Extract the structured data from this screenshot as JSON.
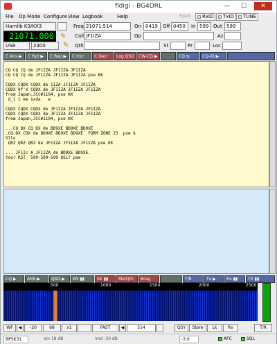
{
  "window": {
    "title": "fldigi - BG4DRL",
    "minimize": "—",
    "maximize": "☐",
    "close": "✕"
  },
  "menu": [
    "File",
    "Op Mode",
    "Configure",
    "View",
    "Logbook",
    "Help"
  ],
  "status_buttons": {
    "spot": "Spot",
    "rxid": "RxID",
    "txid": "TxID",
    "tune": "TUNE"
  },
  "rig": {
    "name": "Hamlib K3/KX3",
    "freq_display": "21071.000",
    "mode": "USB",
    "bw": "2400"
  },
  "log": {
    "freq_label": "Freq",
    "freq": "21071.514",
    "on_label": "On",
    "on": "0419",
    "off_label": "Off",
    "off": "0450",
    "in_label": "In",
    "in": "599",
    "out_label": "Out",
    "out": "599",
    "call_label": "Call",
    "call": "JF1IZA",
    "op_label": "Op",
    "az_label": "Az",
    "qth_label": "Qth",
    "st_label": "St",
    "pr_label": "Pr",
    "loc_label": "Loc"
  },
  "macros": [
    "C Ans ▶",
    "C Rpt ▶",
    "C Rep ▶",
    "C Incr",
    "C Decr",
    "Log QSO",
    "CW-CQ ▶",
    "CQ ⇆",
    "CQ-ID ▶"
  ],
  "macros2": [
    "CQ ▶",
    "ANS ▶",
    "QSO ▶",
    "KN ▮▮",
    "SK ▮▮",
    "Me/Qth",
    "Brag",
    "T/R",
    "Tx ▶",
    "Rx ▮▮",
    "TX ▮▮"
  ],
  "rx_text": "\nCQ CQ CQ de JF1IZA JF1IZA JF1IZA\nCQ CQ CQ de JF1IZA JF1IZA JF1IZA pse KK\n\nCQDX CQDX CQDX de 1IZA JF1IZA JF1IZA\nCQDX 0f'X CQDX de JF1IZA JF1IZA JF1IZA\nfrom Japan,JCC#1104, pse KK\n d_i i ee sxda   e\n\nCQDX CQDX CQDX de JF1IZA JF1IZA JF1IZA\nCQDX CQDX CQDX de JF1IZA JF1IZA JF1IZA\nfrom Japan,JCC#1104, pse KK\n\n...CQ DX CQ DX de BD9XE BD9XE BD9XE\n.CQ DX CDX de BD9XE BD9XE BD9XE  FORM ZONE 23  pse k\nSllo\n QRZ QRZ QRZ de JF1IZA JF1IZA JF1IZA pse KK\n\n... JF1Ic A JF1IZA de BD9XE BD9XE.\nYour RST  599-599-599 QSL? pse",
  "ruler": [
    "500",
    "1000",
    "1500",
    "2000",
    "2500"
  ],
  "ctrl": {
    "wf": "WF",
    "left": "◀",
    "rfmin": "-20",
    "db": "68",
    "x1": "x1",
    "fast": "FAST",
    "sep": "◀",
    "center": "514",
    "qsy": "QSY",
    "store": "Store",
    "lk": "Lk",
    "rv": "Rv",
    "tr": "T/R"
  },
  "status": {
    "mode": "BPSK31",
    "sn": "s/n 18 dB",
    "imd": "imd -30 dB",
    "afc_val": "-3.0",
    "afc": "AFC",
    "sql": "SQL"
  }
}
